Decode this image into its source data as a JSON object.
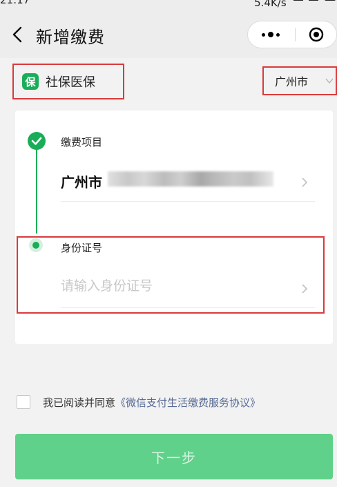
{
  "status_bar": {
    "time": "21:17",
    "network_speed": "5.4K/s"
  },
  "nav": {
    "title": "新增缴费"
  },
  "service": {
    "icon_char": "保",
    "label": "社保医保",
    "accent_color": "#1aad57"
  },
  "city_select": {
    "selected": "广州市"
  },
  "form": {
    "step1": {
      "label": "缴费项目",
      "value": "广州市"
    },
    "step2": {
      "label": "身份证号",
      "placeholder": "请输入身份证号",
      "value": ""
    }
  },
  "agreement": {
    "prefix": "我已阅读并同意",
    "link": "《微信支付生活缴费服务协议》",
    "checked": false
  },
  "next_button": {
    "label": "下一步",
    "enabled": false
  },
  "colors": {
    "highlight_border": "#d93a3a",
    "button_bg": "#5fd18a",
    "link": "#576b95"
  }
}
